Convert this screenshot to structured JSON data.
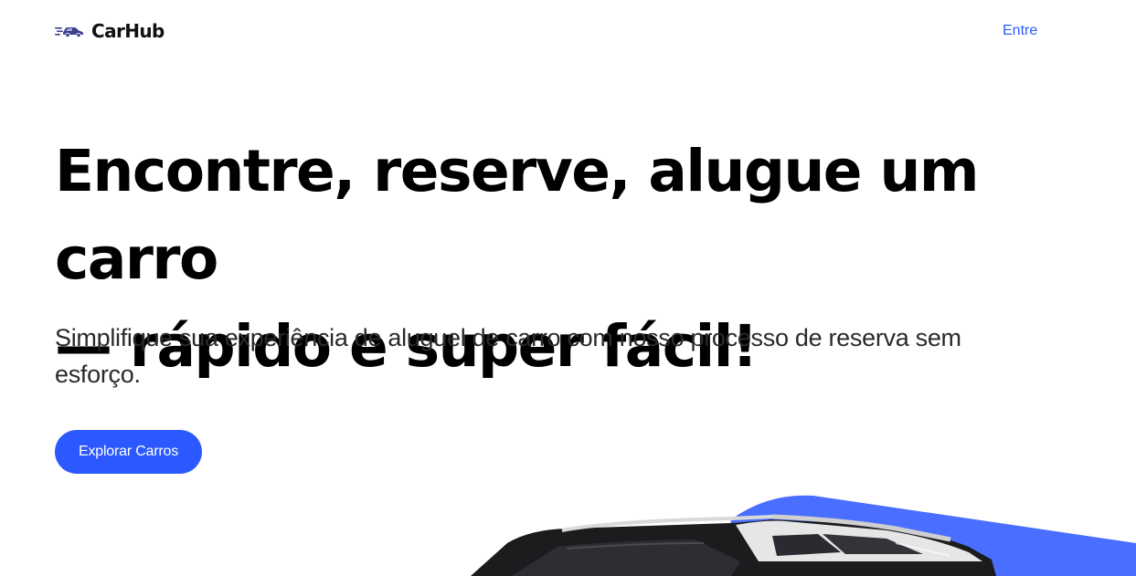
{
  "navbar": {
    "logo_icon": "car-speed-icon",
    "logo_text": "CarHub",
    "signin_label": "Entre"
  },
  "hero": {
    "title_line1": "Encontre, reserve, alugue um carro",
    "title_line2": "— rápido e super fácil!",
    "subtitle": "Simplifique sua experiência de aluguel de carro com nosso processo de reserva sem esforço.",
    "button_label": "Explorar Carros"
  },
  "colors": {
    "accent": "#2B59FF",
    "accent_shape": "#4A6EFF",
    "text": "#000000"
  }
}
